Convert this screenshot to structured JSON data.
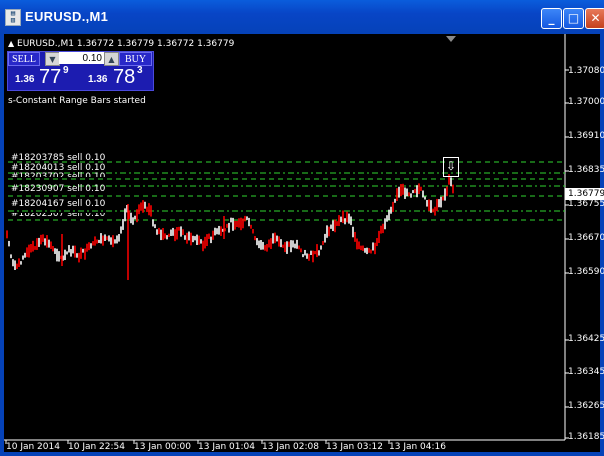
{
  "window": {
    "title": "EURUSD.,M1",
    "icon": "metatrader-chart-icon",
    "buttons": {
      "minimize": "_",
      "maximize": "□",
      "close": "✕"
    }
  },
  "chart": {
    "header": "EURUSD.,M1  1.36772 1.36779 1.36772 1.36779",
    "status_text": "s-Constant Range Bars started",
    "current_price": "1.36779",
    "background": "#000000",
    "up_color": "#ffffff",
    "down_color": "#ff0000",
    "order_line_color": "#2fd52f"
  },
  "trade_panel": {
    "sell_label": "SELL",
    "buy_label": "BUY",
    "lot": "0.10",
    "sell_price_prefix": "1.36",
    "sell_price_big": "77",
    "sell_price_sup": "9",
    "buy_price_prefix": "1.36",
    "buy_price_big": "78",
    "buy_price_sup": "3"
  },
  "orders": [
    {
      "label": "#18203785 sell 0.10"
    },
    {
      "label": "#18204013 sell 0.10"
    },
    {
      "label": "#18203702 sell 0.10"
    },
    {
      "label": "#18230907 sell 0.10"
    },
    {
      "label": "#18204167 sell 0.10"
    },
    {
      "label": "#18202507 sell 0.10"
    }
  ],
  "y_axis": [
    "1.37080",
    "1.37000",
    "1.36910",
    "1.36835",
    "1.36755",
    "1.36670",
    "1.36590",
    "1.36425",
    "1.36345",
    "1.36265",
    "1.36185"
  ],
  "x_axis": [
    "10 Jan 2014",
    "10 Jan 22:54",
    "13 Jan 00:00",
    "13 Jan 01:04",
    "13 Jan 02:08",
    "13 Jan 03:12",
    "13 Jan 04:16"
  ]
}
